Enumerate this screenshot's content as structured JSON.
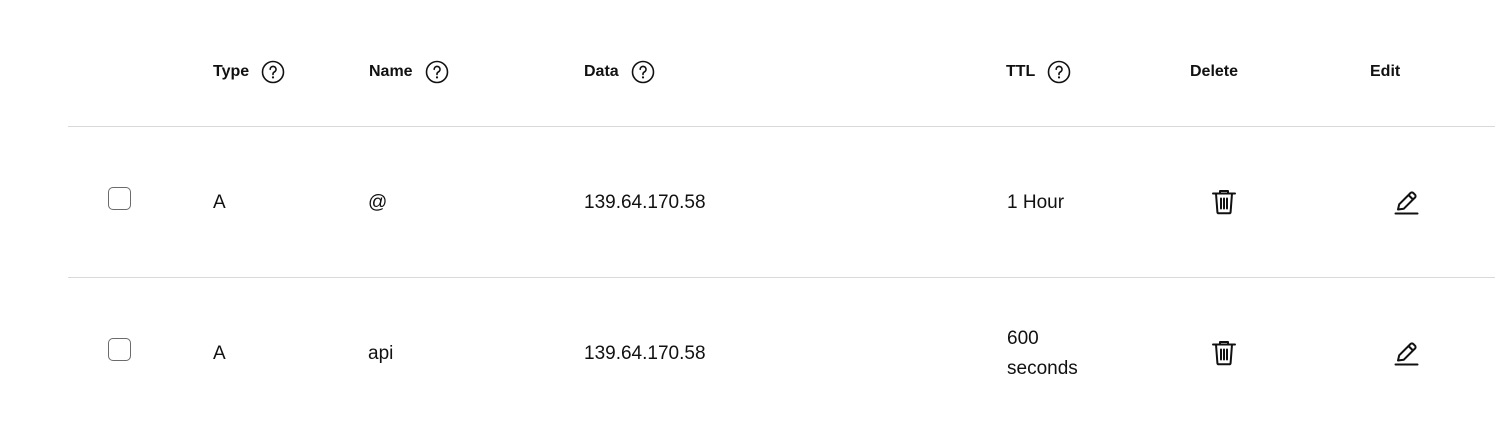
{
  "table": {
    "headers": {
      "type": "Type",
      "name": "Name",
      "data": "Data",
      "ttl": "TTL",
      "delete": "Delete",
      "edit": "Edit"
    },
    "records": [
      {
        "type": "A",
        "name": "@",
        "data": "139.64.170.58",
        "ttl": "1 Hour",
        "checked": false
      },
      {
        "type": "A",
        "name": "api",
        "data": "139.64.170.58",
        "ttl": "600 seconds",
        "checked": false
      }
    ]
  },
  "icons": {
    "help": "question-circle-icon",
    "delete": "trash-icon",
    "edit": "pencil-icon"
  },
  "colors": {
    "text": "#111111",
    "divider": "#d9d9d9",
    "checkbox_border": "#6b6b6b"
  }
}
